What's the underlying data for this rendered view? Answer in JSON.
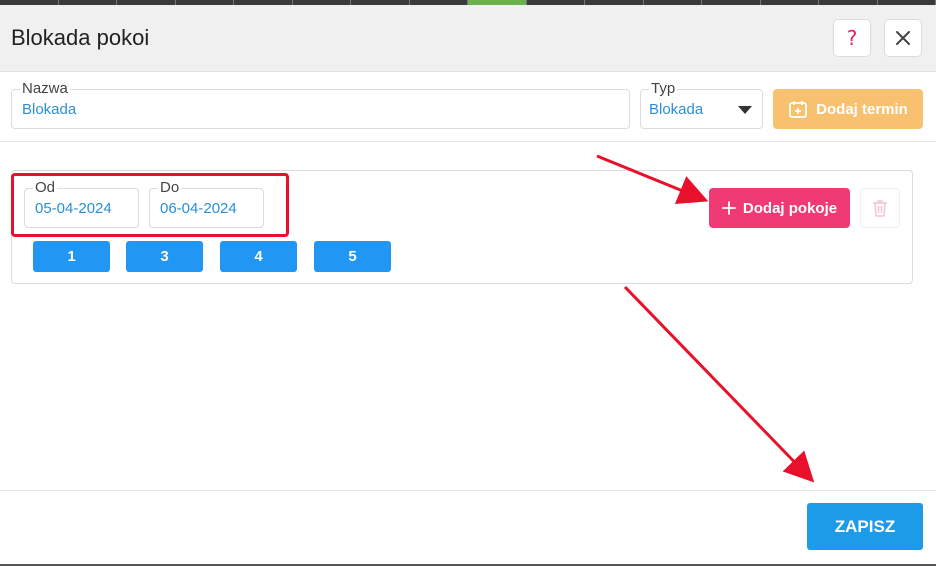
{
  "dialog": {
    "title": "Blokada pokoi",
    "help_icon": "question-icon",
    "close_icon": "close-icon"
  },
  "form": {
    "name": {
      "label": "Nazwa",
      "value": "Blokada"
    },
    "type": {
      "label": "Typ",
      "value": "Blokada"
    },
    "add_term_label": "Dodaj termin",
    "add_term_icon": "calendar-plus-icon"
  },
  "term": {
    "from": {
      "label": "Od",
      "value": "05-04-2024"
    },
    "to": {
      "label": "Do",
      "value": "06-04-2024"
    },
    "rooms": [
      "1",
      "3",
      "4",
      "5"
    ],
    "add_rooms_label": "Dodaj pokoje",
    "add_rooms_icon": "plus-icon",
    "delete_icon": "trash-icon"
  },
  "footer": {
    "save_label": "ZAPISZ"
  },
  "colors": {
    "accent_blue": "#2196f3",
    "save_blue": "#1d9be8",
    "add_term_orange": "#f8c170",
    "add_rooms_pink": "#ef3a74",
    "annotation_red": "#e8102a"
  }
}
